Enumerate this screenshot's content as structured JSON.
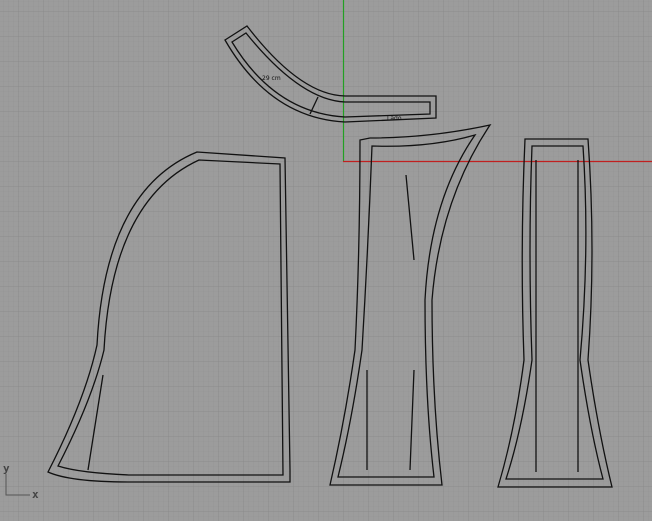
{
  "viewport": {
    "background": "#9c9c9c",
    "grid_minor": "#8f8f8f",
    "grid_major": "#858585",
    "x_axis_color": "#c02020",
    "y_axis_color": "#20a020"
  },
  "axis_icon": {
    "x_label": "x",
    "y_label": "y"
  },
  "pieces": {
    "waistband": {
      "label_1": "29 cm",
      "label_2": "Lado"
    }
  }
}
